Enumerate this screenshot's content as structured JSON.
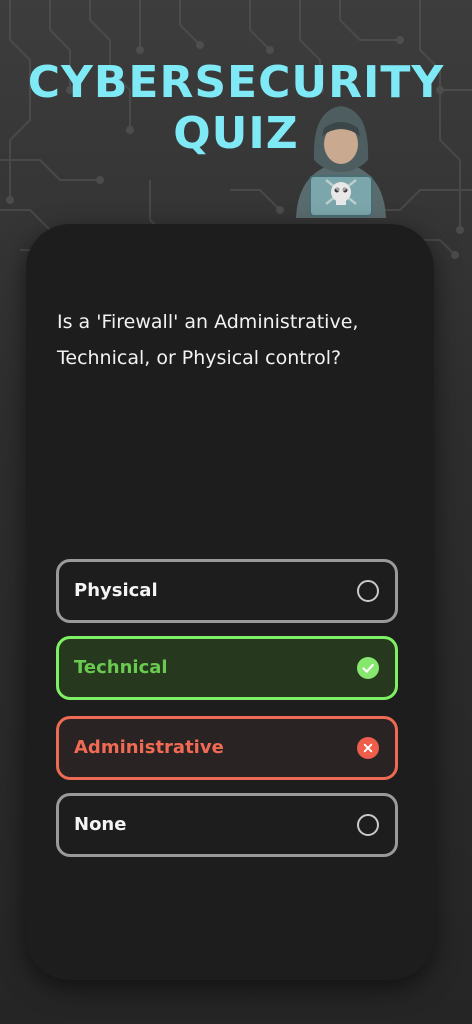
{
  "header": {
    "title_line1": "CYBERSECURITY",
    "title_line2": "QUIZ",
    "accent_color": "#7fe9f6",
    "illustration": "hacker-with-skull-laptop-icon"
  },
  "quiz": {
    "question": "Is a 'Firewall' an Administrative, Technical, or Physical control?",
    "options": [
      {
        "label": "Physical",
        "state": "unselected",
        "icon": "radio-empty-icon"
      },
      {
        "label": "Technical",
        "state": "correct",
        "icon": "check-circle-icon"
      },
      {
        "label": "Administrative",
        "state": "incorrect",
        "icon": "x-circle-icon"
      },
      {
        "label": "None",
        "state": "unselected",
        "icon": "radio-empty-icon"
      }
    ],
    "colors": {
      "correct": "#7ef064",
      "incorrect": "#ed6b55",
      "neutral": "#9a9a9a"
    }
  }
}
